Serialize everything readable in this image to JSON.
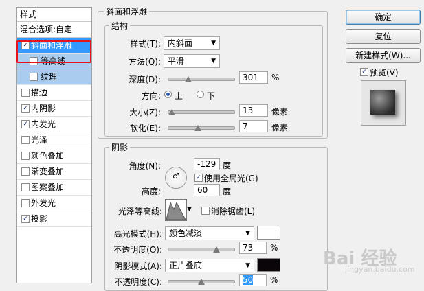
{
  "styles_panel": {
    "header": "样式",
    "blend_options": "混合选项:自定",
    "items": [
      {
        "label": "斜面和浮雕",
        "checked": true,
        "level": 0,
        "state": "selected"
      },
      {
        "label": "等高线",
        "checked": false,
        "level": 1,
        "state": "subsel"
      },
      {
        "label": "纹理",
        "checked": false,
        "level": 1,
        "state": "subsel"
      },
      {
        "label": "描边",
        "checked": false,
        "level": 0,
        "state": ""
      },
      {
        "label": "内阴影",
        "checked": true,
        "level": 0,
        "state": ""
      },
      {
        "label": "内发光",
        "checked": true,
        "level": 0,
        "state": ""
      },
      {
        "label": "光泽",
        "checked": false,
        "level": 0,
        "state": ""
      },
      {
        "label": "颜色叠加",
        "checked": false,
        "level": 0,
        "state": ""
      },
      {
        "label": "渐变叠加",
        "checked": false,
        "level": 0,
        "state": ""
      },
      {
        "label": "图案叠加",
        "checked": false,
        "level": 0,
        "state": ""
      },
      {
        "label": "外发光",
        "checked": false,
        "level": 0,
        "state": ""
      },
      {
        "label": "投影",
        "checked": true,
        "level": 0,
        "state": ""
      }
    ]
  },
  "bevel": {
    "title": "斜面和浮雕",
    "structure_title": "结构",
    "style_label": "样式(T):",
    "style_value": "内斜面",
    "method_label": "方法(Q):",
    "method_value": "平滑",
    "depth_label": "深度(D):",
    "depth_value": "301",
    "depth_unit": "%",
    "depth_level": 0.3,
    "direction_label": "方向:",
    "dir_up": "上",
    "dir_down": "下",
    "size_label": "大小(Z):",
    "size_value": "13",
    "size_unit": "像素",
    "size_level": 0.05,
    "soften_label": "软化(E):",
    "soften_value": "7",
    "soften_unit": "像素",
    "soften_level": 0.45,
    "shading_title": "阴影",
    "angle_label": "角度(N):",
    "angle_value": "-129",
    "angle_unit": "度",
    "global_light_label": "使用全局光(G)",
    "global_light_checked": true,
    "altitude_label": "高度:",
    "altitude_value": "60",
    "altitude_unit": "度",
    "gloss_label": "光泽等高线:",
    "antialias_label": "消除锯齿(L)",
    "highlight_label": "高光模式(H):",
    "highlight_mode": "颜色减淡",
    "highlight_color": "#ffffff",
    "hl_opacity_label": "不透明度(O):",
    "hl_opacity_value": "73",
    "hl_opacity_unit": "%",
    "hl_opacity_level": 0.73,
    "shadow_label": "阴影模式(A):",
    "shadow_mode": "正片叠底",
    "shadow_color": "#0a0508",
    "sh_opacity_label": "不透明度(C):",
    "sh_opacity_value": "50",
    "sh_opacity_unit": "%",
    "sh_opacity_level": 0.5
  },
  "buttons": {
    "ok": "确定",
    "reset": "复位",
    "new_style": "新建样式(W)...",
    "preview_label": "预览(V)",
    "preview_checked": true
  },
  "watermark": {
    "text": "Bai 经验",
    "sub": "jingyan.baidu.com"
  }
}
